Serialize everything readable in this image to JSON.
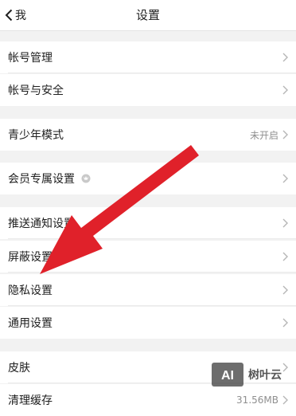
{
  "header": {
    "back_label": "我",
    "title": "设置"
  },
  "rows": [
    {
      "label": "帐号管理",
      "value": ""
    },
    {
      "label": "帐号与安全",
      "value": ""
    },
    {
      "label": "青少年模式",
      "value": "未开启"
    },
    {
      "label": "会员专属设置",
      "value": ""
    },
    {
      "label": "推送通知设置",
      "value": ""
    },
    {
      "label": "屏蔽设置",
      "value": ""
    },
    {
      "label": "隐私设置",
      "value": ""
    },
    {
      "label": "通用设置",
      "value": ""
    },
    {
      "label": "皮肤",
      "value": ""
    },
    {
      "label": "清理缓存",
      "value": "31.56MB"
    }
  ],
  "icons": {
    "back": "chevron-left-icon",
    "row_arrow": "chevron-right-icon",
    "vip_badge": "vip-crown-icon"
  },
  "colors": {
    "background": "#f2f2f2",
    "row": "#ffffff",
    "annotation_arrow": "#e0212a"
  },
  "watermark": {
    "logo_text": "AI",
    "text": "树叶云"
  }
}
